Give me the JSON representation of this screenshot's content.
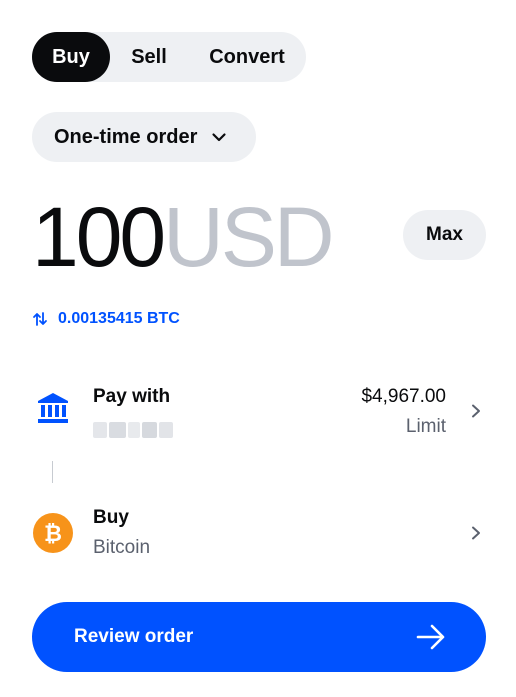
{
  "tabs": {
    "buy": "Buy",
    "sell": "Sell",
    "convert": "Convert"
  },
  "order_type": {
    "label": "One-time order",
    "icon": "chevron-down-icon"
  },
  "amount": {
    "value": "100",
    "currency": "USD"
  },
  "max_label": "Max",
  "conversion": {
    "icon": "swap-arrows-icon",
    "text": "0.00135415 BTC"
  },
  "pay_with": {
    "title": "Pay with",
    "amount": "$4,967.00",
    "limit_label": "Limit",
    "icon": "bank-icon"
  },
  "buy_asset": {
    "title": "Buy",
    "asset": "Bitcoin",
    "icon": "bitcoin-icon"
  },
  "review": {
    "label": "Review order",
    "icon": "arrow-right-icon"
  },
  "colors": {
    "primary": "#0052ff",
    "dark": "#0a0b0d",
    "pill_bg": "#eef0f3",
    "muted_text": "#5b616e",
    "currency_text": "#c0c4cc",
    "bitcoin": "#f7931a"
  }
}
